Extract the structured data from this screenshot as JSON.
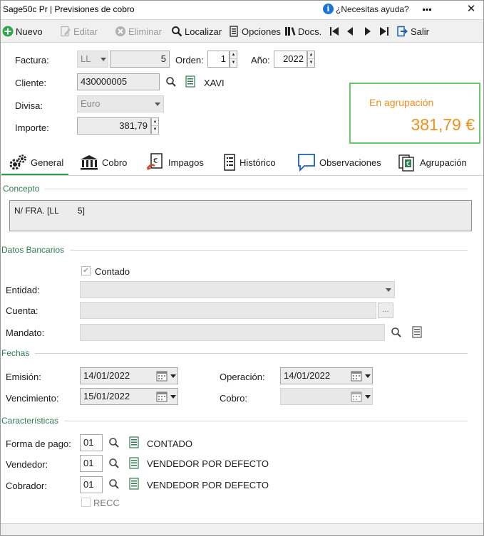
{
  "window": {
    "title": "Sage50c Pr | Previsiones de cobro",
    "help": "¿Necesitas ayuda?",
    "minimize": "▪▪▪",
    "close": "✕"
  },
  "toolbar": {
    "nuevo": "Nuevo",
    "editar": "Editar",
    "eliminar": "Eliminar",
    "localizar": "Localizar",
    "opciones": "Opciones",
    "docs": "Docs.",
    "salir": "Salir"
  },
  "header": {
    "factura_label": "Factura:",
    "factura_serie": "LL",
    "factura_numero": "5",
    "orden_label": "Orden:",
    "orden_value": "1",
    "anio_label": "Año:",
    "anio_value": "2022",
    "cliente_label": "Cliente:",
    "cliente_value": "430000005",
    "cliente_nombre": "XAVI",
    "divisa_label": "Divisa:",
    "divisa_value": "Euro",
    "importe_label": "Importe:",
    "importe_value": "381,79"
  },
  "agrupacion": {
    "label": "En agrupación",
    "value": "381,79 €"
  },
  "tabs": [
    {
      "label": "General",
      "icon": "gears-icon",
      "active": true
    },
    {
      "label": "Cobro",
      "icon": "bank-icon",
      "active": false
    },
    {
      "label": "Impagos",
      "icon": "unpaid-document-icon",
      "active": false
    },
    {
      "label": "Histórico",
      "icon": "history-list-icon",
      "active": false
    },
    {
      "label": "Observaciones",
      "icon": "speech-bubble-icon",
      "active": false
    },
    {
      "label": "Agrupación",
      "icon": "grouped-documents-icon",
      "active": false
    }
  ],
  "concepto": {
    "title": "Concepto",
    "text": "N/ FRA. [LL        5]"
  },
  "datos_bancarios": {
    "title": "Datos Bancarios",
    "contado_label": "Contado",
    "contado_checked": true,
    "entidad_label": "Entidad:",
    "entidad_value": "",
    "cuenta_label": "Cuenta:",
    "cuenta_value": "",
    "cuenta_button": "...",
    "mandato_label": "Mandato:",
    "mandato_value": ""
  },
  "fechas": {
    "title": "Fechas",
    "emision_label": "Emisión:",
    "emision_value": "14/01/2022",
    "operacion_label": "Operación:",
    "operacion_value": "14/01/2022",
    "vencimiento_label": "Vencimiento:",
    "vencimiento_value": "15/01/2022",
    "cobro_label": "Cobro:",
    "cobro_value": ""
  },
  "caracteristicas": {
    "title": "Características",
    "forma_pago_label": "Forma de pago:",
    "forma_pago_code": "01",
    "forma_pago_name": "CONTADO",
    "vendedor_label": "Vendedor:",
    "vendedor_code": "01",
    "vendedor_name": "VENDEDOR POR DEFECTO",
    "cobrador_label": "Cobrador:",
    "cobrador_code": "01",
    "cobrador_name": "VENDEDOR POR DEFECTO",
    "recc_label": "RECC",
    "recc_checked": false
  },
  "colors": {
    "accent_green": "#2e7d4f",
    "agrupacion_orange": "#f0901a",
    "agrupacion_border": "#6cc86c",
    "tab_active": "#2b9e48"
  }
}
